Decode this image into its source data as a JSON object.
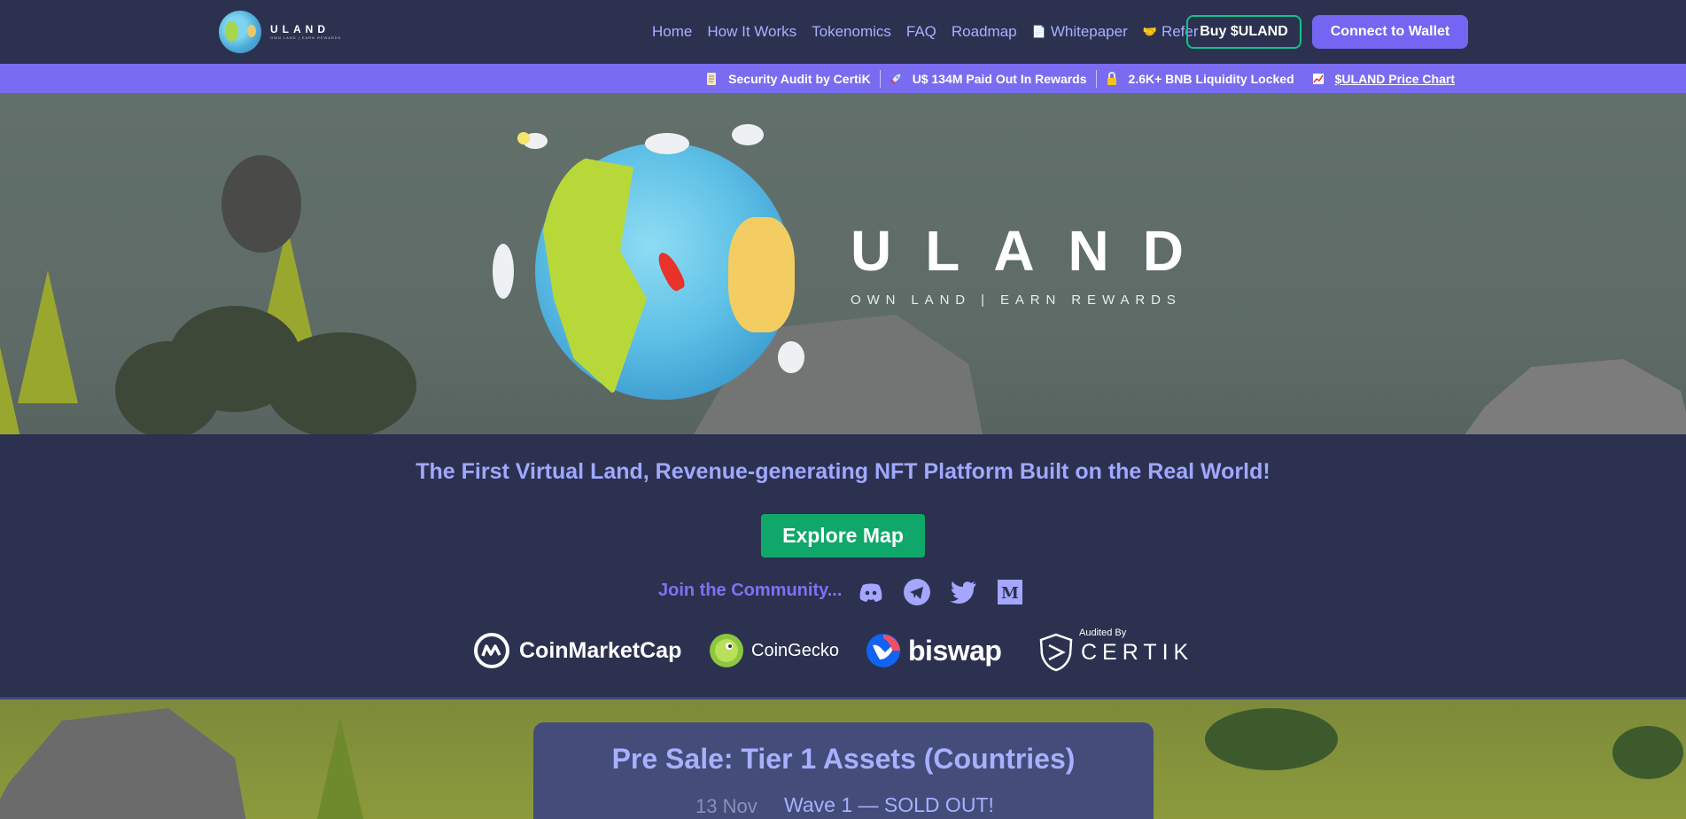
{
  "brand": {
    "logo_name": "ULAND",
    "logo_tagline": "OWN LAND | EARN REWARDS"
  },
  "nav": {
    "items": [
      {
        "label": "Home"
      },
      {
        "label": "How It Works"
      },
      {
        "label": "Tokenomics"
      },
      {
        "label": "FAQ"
      },
      {
        "label": "Roadmap"
      },
      {
        "label": "Whitepaper",
        "icon": "document-icon"
      },
      {
        "label": "Refer",
        "icon": "handshake-icon"
      }
    ],
    "buy_label": "Buy $ULAND",
    "connect_label": "Connect to Wallet"
  },
  "infobar": {
    "items": [
      {
        "label": "Security Audit by CertiK",
        "icon": "scroll-icon"
      },
      {
        "label": "U$ 134M Paid Out In Rewards",
        "icon": "rocket-icon"
      },
      {
        "label": "2.6K+ BNB Liquidity Locked",
        "icon": "lock-icon"
      },
      {
        "label": "$ULAND Price Chart",
        "icon": "chart-icon"
      }
    ]
  },
  "hero": {
    "title": "ULAND",
    "subtitle": "OWN LAND | EARN REWARDS"
  },
  "band": {
    "tagline": "The First Virtual Land, Revenue-generating NFT Platform Built on the Real World!",
    "explore_label": "Explore Map",
    "community_label": "Join the Community...",
    "socials": [
      "discord-icon",
      "telegram-icon",
      "twitter-icon",
      "medium-icon"
    ],
    "partners": {
      "cmc": "CoinMarketCap",
      "coingecko": "CoinGecko",
      "biswap": "biswap",
      "certik_audited": "Audited By",
      "certik": "CERTIK"
    }
  },
  "presale": {
    "title": "Pre Sale: Tier 1 Assets (Countries)",
    "date": "13 Nov",
    "wave": "Wave 1 — SOLD OUT!"
  },
  "colors": {
    "accent": "#7466f2",
    "navbar": "#2c3150",
    "green": "#10a86a",
    "link": "#a8b0ff"
  }
}
